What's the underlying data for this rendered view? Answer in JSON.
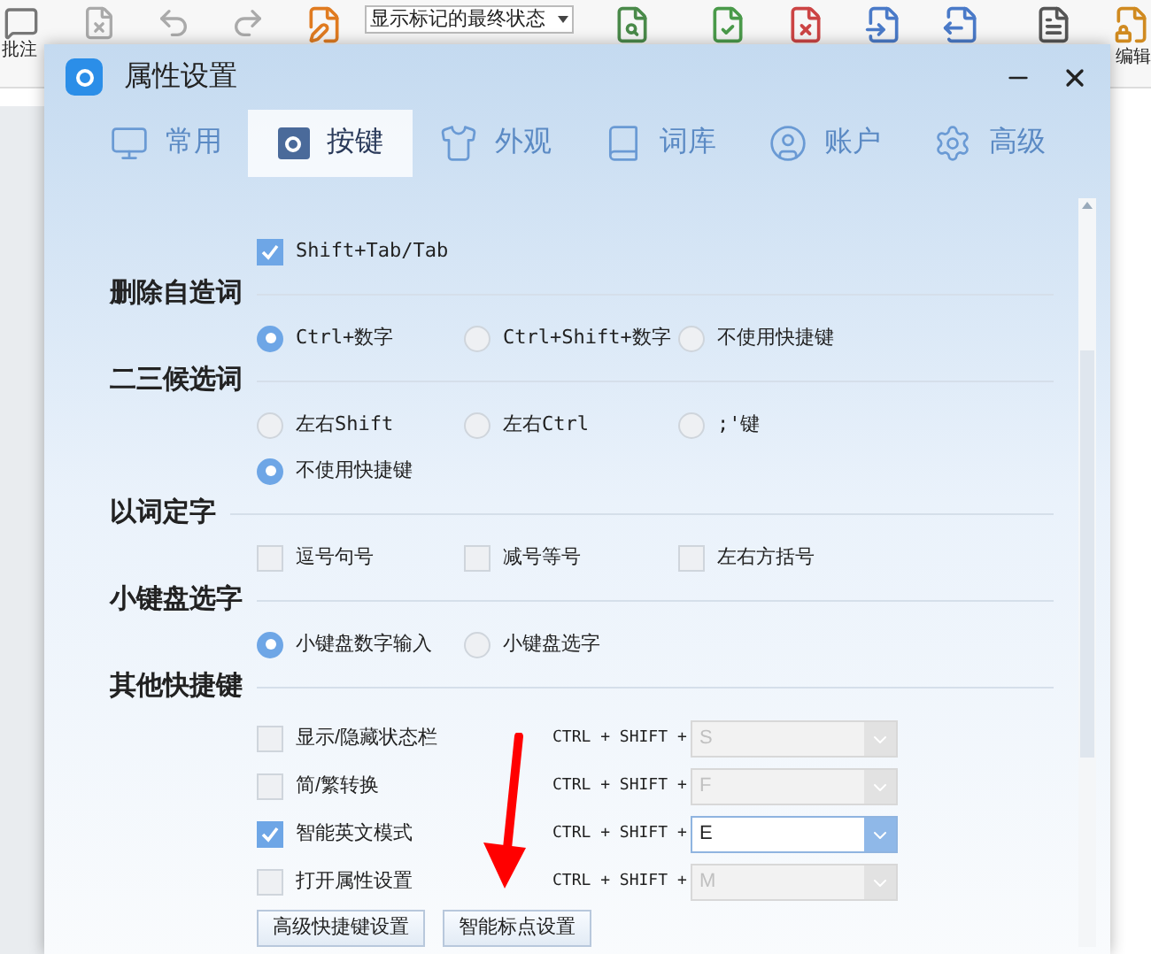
{
  "toolbar": {
    "left_label": "批注",
    "markup_dropdown": "显示标记的最终状态",
    "right_label": "编辑"
  },
  "window": {
    "title": "属性设置"
  },
  "tabs": [
    {
      "label": "常用",
      "selected": false
    },
    {
      "label": "按键",
      "selected": true
    },
    {
      "label": "外观",
      "selected": false
    },
    {
      "label": "词库",
      "selected": false
    },
    {
      "label": "账户",
      "selected": false
    },
    {
      "label": "高级",
      "selected": false
    }
  ],
  "sections": [
    {
      "options": [
        {
          "kind": "checkbox",
          "label": "Shift+Tab/Tab",
          "checked": true
        }
      ]
    },
    {
      "title": "删除自造词",
      "options": [
        {
          "kind": "radio",
          "label": "Ctrl+数字",
          "selected": true
        },
        {
          "kind": "radio",
          "label": "Ctrl+Shift+数字",
          "selected": false
        },
        {
          "kind": "radio",
          "label": "不使用快捷键",
          "selected": false
        }
      ]
    },
    {
      "title": "二三候选词",
      "options": [
        {
          "kind": "radio",
          "label": "左右Shift",
          "selected": false
        },
        {
          "kind": "radio",
          "label": "左右Ctrl",
          "selected": false
        },
        {
          "kind": "radio",
          "label": ";'键",
          "selected": false
        },
        {
          "kind": "radio",
          "label": "不使用快捷键",
          "selected": true
        }
      ]
    },
    {
      "title": "以词定字",
      "options": [
        {
          "kind": "checkbox",
          "label": "逗号句号",
          "checked": false
        },
        {
          "kind": "checkbox",
          "label": "减号等号",
          "checked": false
        },
        {
          "kind": "checkbox",
          "label": "左右方括号",
          "checked": false
        }
      ]
    },
    {
      "title": "小键盘选字",
      "options": [
        {
          "kind": "radio",
          "label": "小键盘数字输入",
          "selected": true
        },
        {
          "kind": "radio",
          "label": "小键盘选字",
          "selected": false
        }
      ]
    },
    {
      "title": "其他快捷键"
    }
  ],
  "shortcuts": [
    {
      "label": "显示/隐藏状态栏",
      "checked": false,
      "modifier": "CTRL + SHIFT +",
      "key": "S",
      "disabled": true
    },
    {
      "label": "简/繁转换",
      "checked": false,
      "modifier": "CTRL + SHIFT +",
      "key": "F",
      "disabled": true
    },
    {
      "label": "智能英文模式",
      "checked": true,
      "modifier": "CTRL + SHIFT +",
      "key": "E",
      "disabled": false
    },
    {
      "label": "打开属性设置",
      "checked": false,
      "modifier": "CTRL + SHIFT +",
      "key": "M",
      "disabled": true
    }
  ],
  "buttons": [
    "高级快捷键设置",
    "智能标点设置"
  ]
}
